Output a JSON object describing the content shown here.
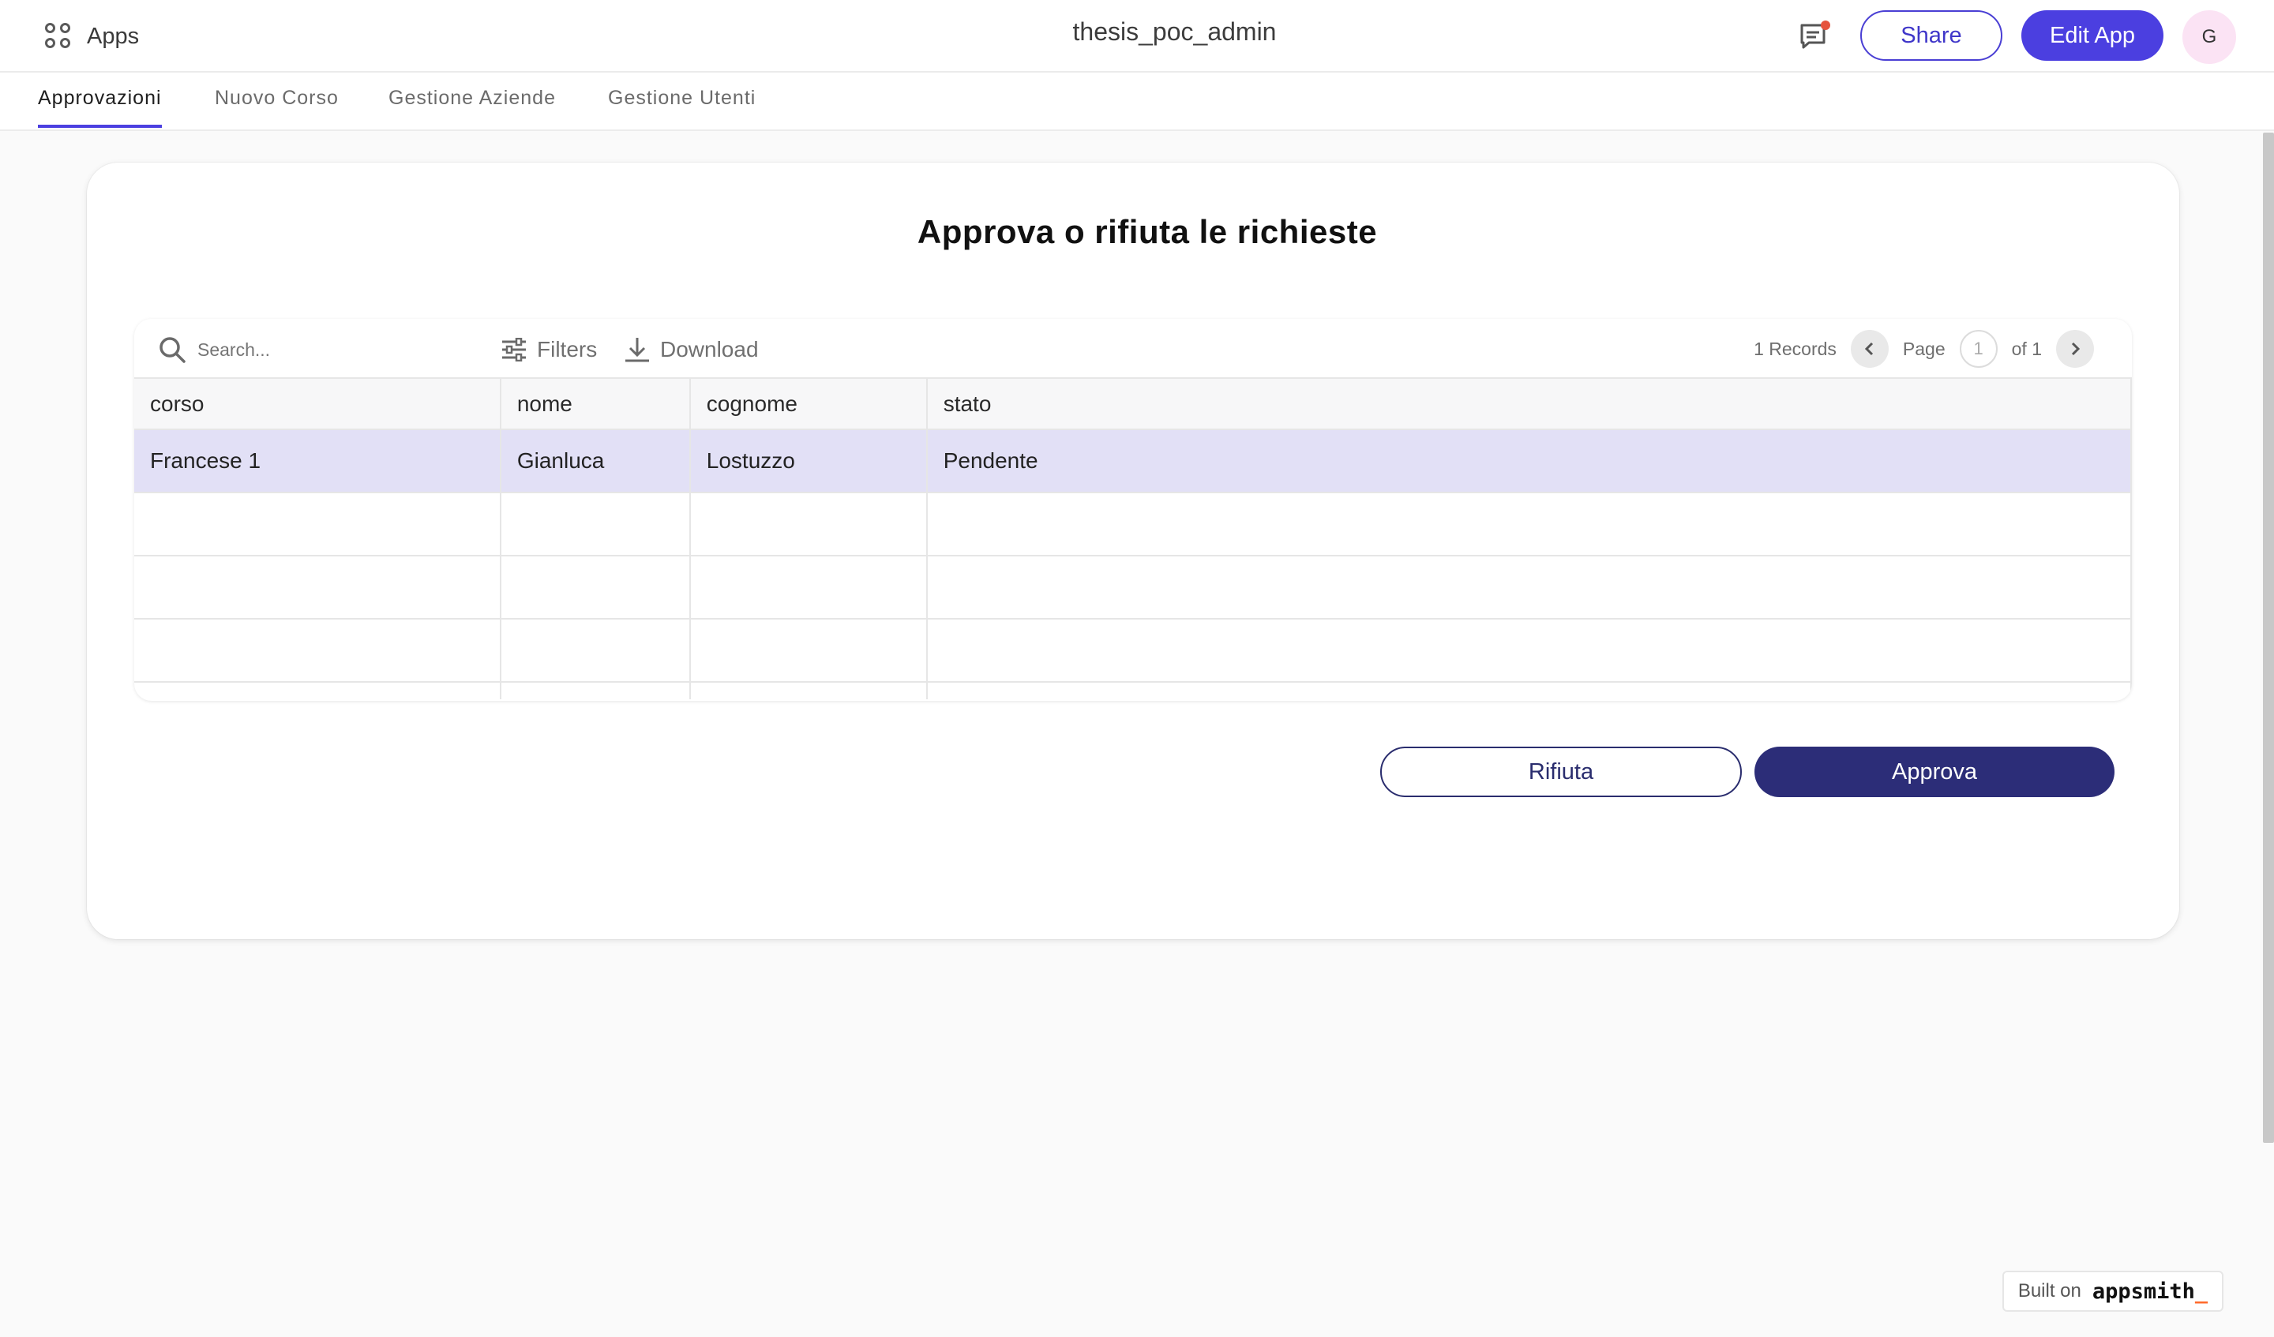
{
  "header": {
    "apps_label": "Apps",
    "title": "thesis_poc_admin",
    "share_label": "Share",
    "edit_label": "Edit App",
    "avatar_initial": "G",
    "notification_color": "#e5533d",
    "accent_color": "#4b3fe0"
  },
  "tabs": [
    {
      "label": "Approvazioni",
      "active": true
    },
    {
      "label": "Nuovo Corso",
      "active": false
    },
    {
      "label": "Gestione Aziende",
      "active": false
    },
    {
      "label": "Gestione Utenti",
      "active": false
    }
  ],
  "card": {
    "title": "Approva o rifiuta le richieste"
  },
  "table": {
    "search_placeholder": "Search...",
    "filters_label": "Filters",
    "download_label": "Download",
    "records_label": "1 Records",
    "page_label": "Page",
    "page_current": "1",
    "page_total_label": "of 1",
    "columns": [
      "corso",
      "nome",
      "cognome",
      "stato"
    ],
    "rows": [
      [
        "Francese 1",
        "Gianluca",
        "Lostuzzo",
        "Pendente"
      ]
    ],
    "selected_row_color": "#e2e0f6"
  },
  "actions": {
    "reject_label": "Rifiuta",
    "approve_label": "Approva"
  },
  "footer": {
    "built_on_label": "Built on",
    "brand": "appsmith",
    "brand_suffix": "_"
  }
}
